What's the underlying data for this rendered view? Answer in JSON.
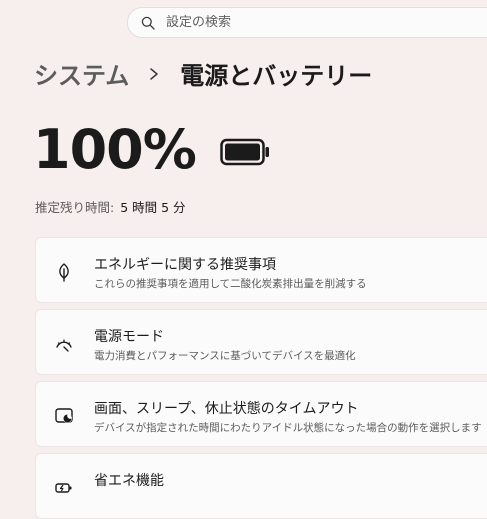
{
  "search": {
    "placeholder": "設定の検索",
    "icon": "search-icon"
  },
  "breadcrumb": {
    "parent": "システム",
    "current": "電源とバッテリー"
  },
  "battery": {
    "percent": "100%",
    "level": 1.0,
    "remaining_label": "推定残り時間:",
    "remaining_value": "5 時間 5 分"
  },
  "settings": [
    {
      "title": "エネルギーに関する推奨事項",
      "subtitle": "これらの推奨事項を適用して二酸化炭素排出量を削減する",
      "icon": "leaf-icon"
    },
    {
      "title": "電源モード",
      "subtitle": "電力消費とパフォーマンスに基づいてデバイスを最適化",
      "icon": "gauge-icon"
    },
    {
      "title": "画面、スリープ、休止状態のタイムアウト",
      "subtitle": "デバイスが指定された時間にわたりアイドル状態になった場合の動作を選択します",
      "icon": "screen-timeout-icon"
    },
    {
      "title": "省エネ機能",
      "subtitle": "",
      "icon": "energy-saver-icon"
    }
  ],
  "colors": {
    "background": "#f6efee",
    "card": "#fbfbfb",
    "text": "#1b1b1b",
    "secondary_text": "#5c5c5c"
  }
}
